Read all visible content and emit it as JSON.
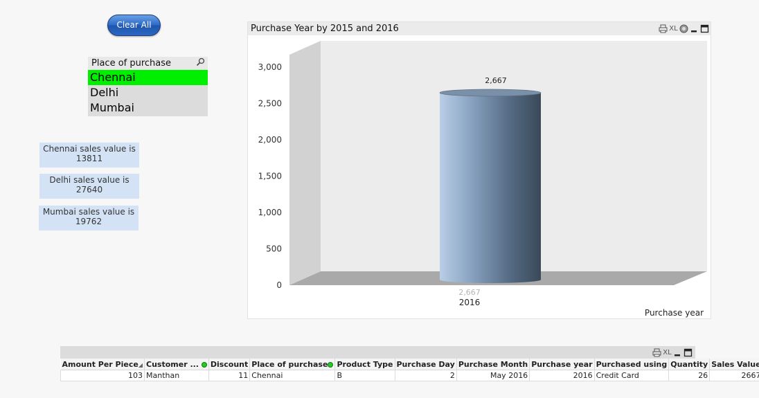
{
  "clear_all_label": "Clear All",
  "listbox": {
    "title": "Place of purchase",
    "items": [
      {
        "label": "Chennai",
        "selected": true
      },
      {
        "label": "Delhi",
        "selected": false
      },
      {
        "label": "Mumbai",
        "selected": false
      }
    ]
  },
  "text_boxes": [
    {
      "line1": "Chennai sales value is",
      "line2": "13811"
    },
    {
      "line1": "Delhi sales value is",
      "line2": "27640"
    },
    {
      "line1": "Mumbai sales value is",
      "line2": "19762"
    }
  ],
  "chart_caption": {
    "title": "Purchase Year by 2015 and 2016",
    "xl_label": "XL"
  },
  "chart_data": {
    "type": "bar",
    "title": "Purchase Year by 2015 and 2016",
    "categories": [
      "2016"
    ],
    "values": [
      2667
    ],
    "data_labels": [
      "2,667"
    ],
    "base_labels": [
      "2,667"
    ],
    "xlabel": "Purchase year",
    "ylabel": "",
    "ylim": [
      0,
      3000
    ],
    "y_ticks": [
      "0",
      "500",
      "1,000",
      "1,500",
      "2,000",
      "2,500",
      "3,000"
    ],
    "grid": false,
    "legend": "none"
  },
  "table": {
    "xl_label": "XL",
    "columns": [
      "Amount Per Piece",
      "Customer ...",
      "Discount",
      "Place of purchase",
      "Product Type",
      "Purchase Day",
      "Purchase Month",
      "Purchase year",
      "Purchased using",
      "Quantity",
      "Sales Value"
    ],
    "rows": [
      [
        "103",
        "Manthan",
        "11",
        "Chennai",
        "B",
        "2",
        "May 2016",
        "2016",
        "Credit Card",
        "26",
        "2667"
      ]
    ]
  },
  "colors": {
    "selected_green": "#00ee00",
    "textbox_blue": "#d3e3f5",
    "bar_light": "#b5cbe3",
    "bar_dark": "#3e4e60"
  }
}
